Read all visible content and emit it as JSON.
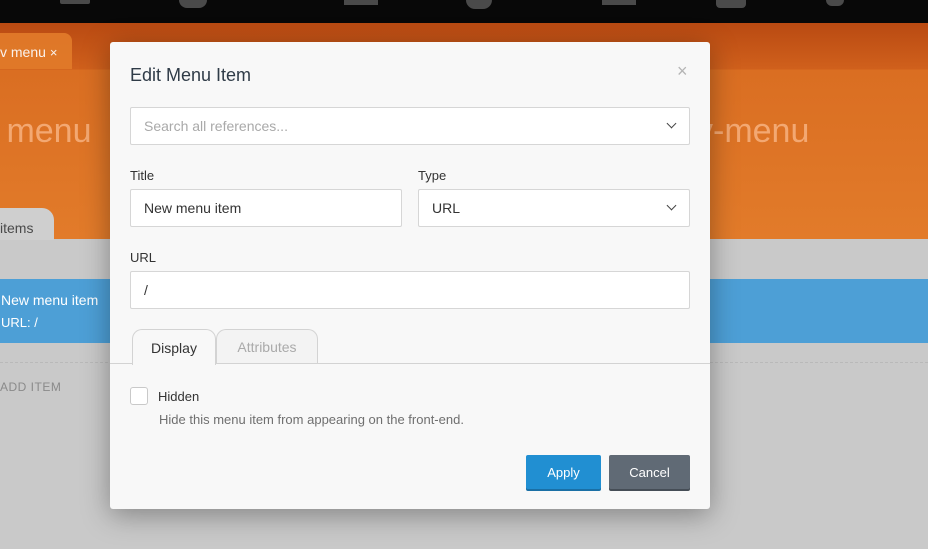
{
  "app": {
    "document_tab": {
      "label": "v menu",
      "close": "×"
    },
    "hero_left": "v menu",
    "hero_right": "v-menu",
    "section_tab": "items",
    "menu_item": {
      "title": "New menu item",
      "url_line": "URL: /"
    },
    "add_item_label": "ADD ITEM",
    "topbar_icons": [
      "menu-icon",
      "user-icon",
      "window-icon",
      "chat-icon",
      "browser-icon",
      "person-icon",
      "gear-icon"
    ]
  },
  "modal": {
    "title": "Edit Menu Item",
    "close": "×",
    "search": {
      "placeholder": "Search all references..."
    },
    "fields": {
      "title_label": "Title",
      "title_value": "New menu item",
      "type_label": "Type",
      "type_value": "URL",
      "url_label": "URL",
      "url_value": "/"
    },
    "tabs": [
      {
        "label": "Display",
        "active": true
      },
      {
        "label": "Attributes",
        "active": false
      }
    ],
    "display": {
      "hidden_label": "Hidden",
      "hidden_checked": false,
      "hidden_help": "Hide this menu item from appearing on the front-end."
    },
    "buttons": {
      "apply": "Apply",
      "cancel": "Cancel"
    }
  },
  "colors": {
    "accent_orange": "#e27b2a",
    "selected_row_blue": "#4d9fd6",
    "apply_blue": "#218fd2",
    "cancel_gray": "#606a75"
  }
}
